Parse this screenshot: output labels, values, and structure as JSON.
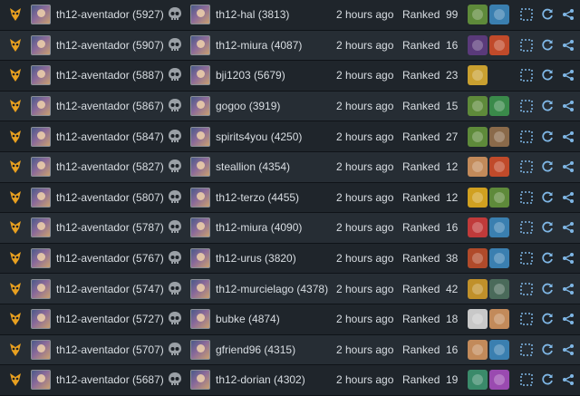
{
  "colors": {
    "accent": "#7fb7e6",
    "skull": "#9aa0a6",
    "mode_icon": "#e8a020"
  },
  "icons": {
    "mode": "goblin-mode-icon",
    "result": "skull-icon",
    "view": "expand-view-icon",
    "replay": "replay-icon",
    "share": "share-icon"
  },
  "rows": [
    {
      "player": "th12-aventador (5927)",
      "opponent": "th12-hal (3813)",
      "time": "2 hours ago",
      "type": "Ranked",
      "turns": "99",
      "cards": [
        {
          "name": "green-creature-card-icon",
          "color": "#5e8a3a"
        },
        {
          "name": "blue-spell-card-icon",
          "color": "#3a7fb0"
        }
      ]
    },
    {
      "player": "th12-aventador (5907)",
      "opponent": "th12-miura (4087)",
      "time": "2 hours ago",
      "type": "Ranked",
      "turns": "16",
      "cards": [
        {
          "name": "dark-creature-card-icon",
          "color": "#5a3a7a"
        },
        {
          "name": "explosion-card-icon",
          "color": "#c04a2a"
        }
      ]
    },
    {
      "player": "th12-aventador (5887)",
      "opponent": "bji1203 (5679)",
      "time": "2 hours ago",
      "type": "Ranked",
      "turns": "23",
      "cards": [
        {
          "name": "golden-bell-card-icon",
          "color": "#c9a030"
        }
      ]
    },
    {
      "player": "th12-aventador (5867)",
      "opponent": "gogoo (3919)",
      "time": "2 hours ago",
      "type": "Ranked",
      "turns": "15",
      "cards": [
        {
          "name": "green-creature-card-icon",
          "color": "#5e8a3a"
        },
        {
          "name": "vine-card-icon",
          "color": "#3a8a4a"
        }
      ]
    },
    {
      "player": "th12-aventador (5847)",
      "opponent": "spirits4you (4250)",
      "time": "2 hours ago",
      "type": "Ranked",
      "turns": "27",
      "cards": [
        {
          "name": "green-creature-card-icon",
          "color": "#5e8a3a"
        },
        {
          "name": "axe-card-icon",
          "color": "#8a6a4a"
        }
      ]
    },
    {
      "player": "th12-aventador (5827)",
      "opponent": "steallion (4354)",
      "time": "2 hours ago",
      "type": "Ranked",
      "turns": "12",
      "cards": [
        {
          "name": "scroll-card-icon",
          "color": "#c28a5a"
        },
        {
          "name": "explosion-card-icon",
          "color": "#c04a2a"
        }
      ]
    },
    {
      "player": "th12-aventador (5807)",
      "opponent": "th12-terzo (4455)",
      "time": "2 hours ago",
      "type": "Ranked",
      "turns": "12",
      "cards": [
        {
          "name": "sun-creature-card-icon",
          "color": "#d0a020"
        },
        {
          "name": "green-creature-card-icon",
          "color": "#5e8a3a"
        }
      ]
    },
    {
      "player": "th12-aventador (5787)",
      "opponent": "th12-miura (4090)",
      "time": "2 hours ago",
      "type": "Ranked",
      "turns": "16",
      "cards": [
        {
          "name": "target-card-icon",
          "color": "#c03a3a"
        },
        {
          "name": "blue-spell-card-icon",
          "color": "#3a7fb0"
        }
      ]
    },
    {
      "player": "th12-aventador (5767)",
      "opponent": "th12-urus (3820)",
      "time": "2 hours ago",
      "type": "Ranked",
      "turns": "38",
      "cards": [
        {
          "name": "dragon-card-icon",
          "color": "#b04a2a"
        },
        {
          "name": "blue-spell-card-icon",
          "color": "#3a7fb0"
        }
      ]
    },
    {
      "player": "th12-aventador (5747)",
      "opponent": "th12-murcielago (4378)",
      "time": "2 hours ago",
      "type": "Ranked",
      "turns": "42",
      "cards": [
        {
          "name": "shield-card-icon",
          "color": "#c0902a"
        },
        {
          "name": "weapon-rack-card-icon",
          "color": "#4a6a5a"
        }
      ]
    },
    {
      "player": "th12-aventador (5727)",
      "opponent": "bubke (4874)",
      "time": "2 hours ago",
      "type": "Ranked",
      "turns": "18",
      "cards": [
        {
          "name": "cloud-card-icon",
          "color": "#c8c8c8"
        },
        {
          "name": "scroll-card-icon",
          "color": "#c28a5a"
        }
      ]
    },
    {
      "player": "th12-aventador (5707)",
      "opponent": "gfriend96 (4315)",
      "time": "2 hours ago",
      "type": "Ranked",
      "turns": "16",
      "cards": [
        {
          "name": "scroll-card-icon",
          "color": "#c28a5a"
        },
        {
          "name": "blue-spell-card-icon",
          "color": "#3a7fb0"
        }
      ]
    },
    {
      "player": "th12-aventador (5687)",
      "opponent": "th12-dorian (4302)",
      "time": "2 hours ago",
      "type": "Ranked",
      "turns": "19",
      "cards": [
        {
          "name": "books-card-icon",
          "color": "#3a8a6a"
        },
        {
          "name": "wheel-card-icon",
          "color": "#9a4ab0"
        }
      ]
    }
  ]
}
